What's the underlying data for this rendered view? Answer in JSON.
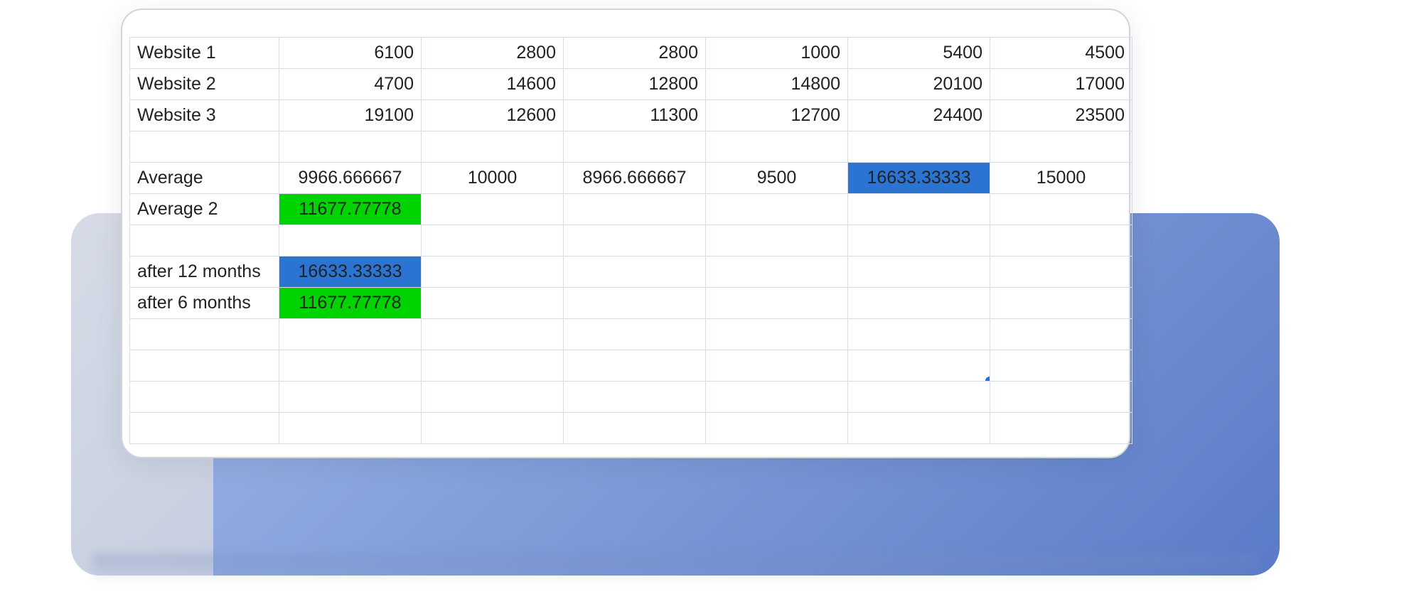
{
  "rows": {
    "w1": {
      "label": "Website 1",
      "c": [
        "6100",
        "2800",
        "2800",
        "1000",
        "5400",
        "4500"
      ]
    },
    "w2": {
      "label": "Website 2",
      "c": [
        "4700",
        "14600",
        "12800",
        "14800",
        "20100",
        "17000"
      ]
    },
    "w3": {
      "label": "Website 3",
      "c": [
        "19100",
        "12600",
        "11300",
        "12700",
        "24400",
        "23500"
      ]
    },
    "avg": {
      "label": "Average",
      "c": [
        "9966.666667",
        "10000",
        "8966.666667",
        "9500",
        "16633.33333",
        "15000"
      ]
    },
    "avg2": {
      "label": "Average 2",
      "c": [
        "11677.77778",
        "",
        "",
        "",
        "",
        ""
      ]
    },
    "a12": {
      "label": "after 12 months",
      "c": [
        "16633.33333",
        "",
        "",
        "",
        "",
        ""
      ]
    },
    "a6": {
      "label": "after 6 months",
      "c": [
        "11677.77778",
        "",
        "",
        "",
        "",
        ""
      ]
    }
  },
  "colors": {
    "green": "#00d400",
    "blue": "#2b74d1",
    "selection": "#1a73e8"
  }
}
